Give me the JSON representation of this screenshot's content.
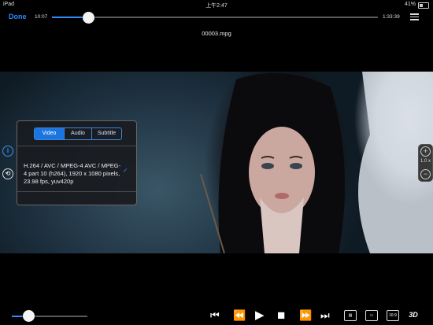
{
  "status_bar": {
    "device": "iPad",
    "time": "上午2:47",
    "battery": "41%",
    "battery_level": 0.41
  },
  "top_bar": {
    "done_label": "Done",
    "current_time": "10:07",
    "total_time": "1:33:39",
    "progress": 0.11
  },
  "file_name": "00003.mpg",
  "settings_panel": {
    "tabs": [
      {
        "label": "Video",
        "selected": true
      },
      {
        "label": "Audio",
        "selected": false
      },
      {
        "label": "Subtitle",
        "selected": false
      }
    ],
    "track_info": "H.264 / AVC / MPEG-4 AVC / MPEG-4 part 10 (h264), 1920 x 1080 pixels, 23.98 fps, yuv420p"
  },
  "zoom": {
    "level": "1.0 x"
  },
  "bottom_bar": {
    "volume_level": 0.22,
    "buttons": [
      {
        "name": "skip-back",
        "glyph": "⏮"
      },
      {
        "name": "rewind",
        "glyph": "⏪"
      },
      {
        "name": "play",
        "glyph": "▶"
      },
      {
        "name": "stop",
        "glyph": "■"
      },
      {
        "name": "fast-forward",
        "glyph": "⏩"
      },
      {
        "name": "skip-forward",
        "glyph": "⏭"
      }
    ],
    "aspect_label": "16:9",
    "mode_3d": "3D"
  },
  "colors": {
    "accent": "#2e8bff",
    "background": "#000000"
  }
}
